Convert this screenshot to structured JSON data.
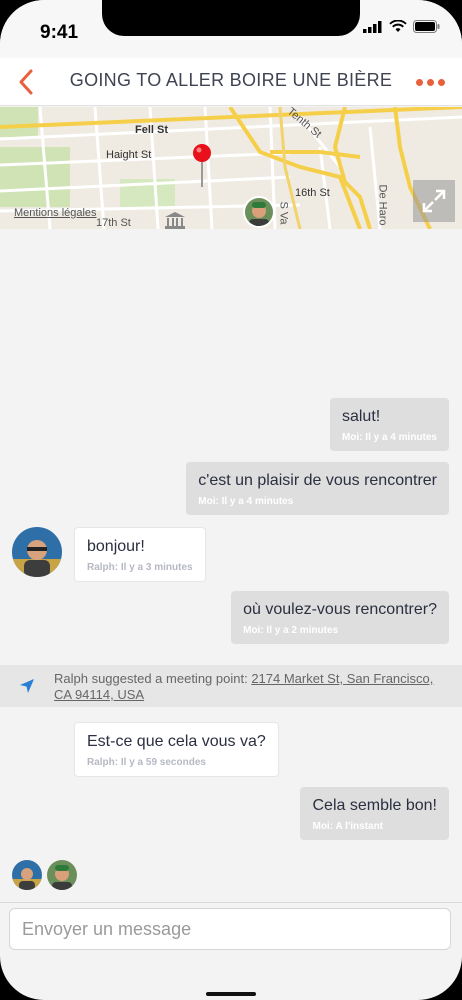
{
  "status_bar": {
    "time": "9:41"
  },
  "header": {
    "title": "GOING TO ALLER BOIRE UNE BIÈRE"
  },
  "map": {
    "street_labels": [
      "Fell St",
      "Haight St",
      "16th St",
      "17th St",
      "Tenth St",
      "De Haro",
      "S Va"
    ],
    "legal_link": "Mentions légales"
  },
  "messages": [
    {
      "direction": "out",
      "text": "salut!",
      "meta": "Moi: Il y a 4 minutes"
    },
    {
      "direction": "out",
      "text": "c'est un plaisir de vous rencontrer",
      "meta": "Moi: Il y a 4 minutes"
    },
    {
      "direction": "in",
      "text": "bonjour!",
      "meta": "Ralph: Il y a 3 minutes"
    },
    {
      "direction": "out",
      "text": "où voulez-vous rencontrer?",
      "meta": "Moi: Il y a 2 minutes"
    },
    {
      "direction": "in",
      "text": "Est-ce que cela vous va?",
      "meta": "Ralph: Il y a 59 secondes"
    },
    {
      "direction": "out",
      "text": "Cela semble bon!",
      "meta": "Moi: A l'instant"
    }
  ],
  "suggestion": {
    "prefix": "Ralph suggested a meeting point: ",
    "address": "2174 Market St, San Francisco, CA 94114, USA"
  },
  "composer": {
    "placeholder": "Envoyer un message"
  },
  "colors": {
    "accent": "#e8603c",
    "outgoing_bubble": "#dedede",
    "incoming_bubble": "#ffffff",
    "background": "#f3f3f3"
  }
}
